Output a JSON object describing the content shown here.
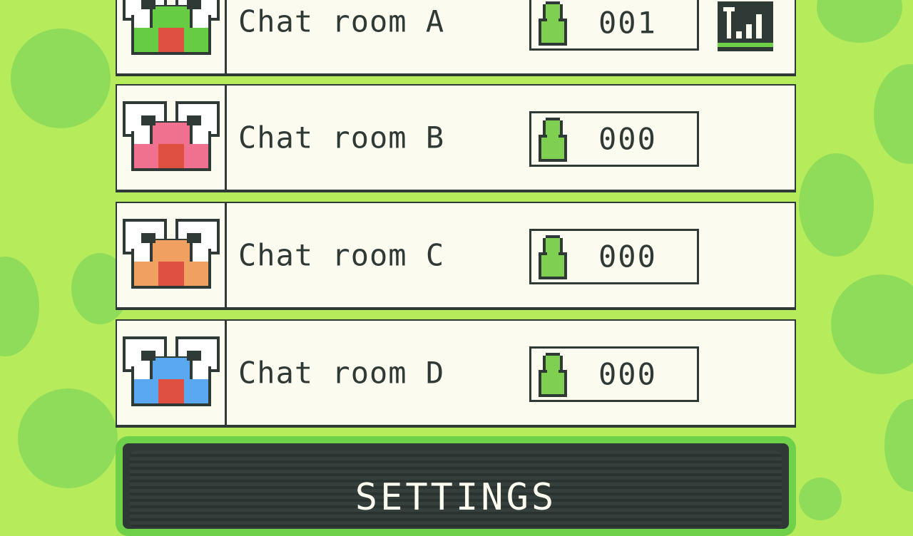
{
  "rooms": [
    {
      "name": "Chat room A",
      "count": "001",
      "color": "#66cc44",
      "signal": true
    },
    {
      "name": "Chat room B",
      "count": "000",
      "color": "#f07090",
      "signal": false
    },
    {
      "name": "Chat room C",
      "count": "000",
      "color": "#f0a060",
      "signal": false
    },
    {
      "name": "Chat room D",
      "count": "000",
      "color": "#5aa8f0",
      "signal": false
    }
  ],
  "settings_label": "SETTINGS",
  "colors": {
    "background": "#b6ec5c",
    "background_dots": "#8fdc5a",
    "panel": "#fbfbef",
    "ink": "#2f3a36",
    "user_icon": "#7fd050",
    "mouth": "#e05040"
  },
  "icons": [
    "bird-face-icon",
    "user-icon",
    "signal-strength-icon"
  ]
}
